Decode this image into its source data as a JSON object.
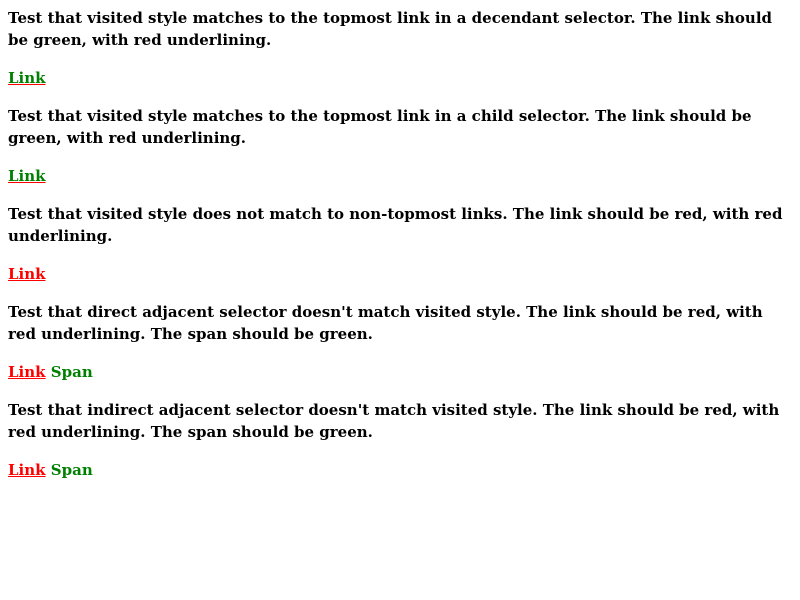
{
  "tests": [
    {
      "description": "Test that visited style matches to the topmost link in a decendant selector. The link should be green, with red underlining.",
      "link": "Link"
    },
    {
      "description": "Test that visited style matches to the topmost link in a child selector. The link should be green, with red underlining.",
      "link": "Link"
    },
    {
      "description": "Test that visited style does not match to non-topmost links. The link should be red, with red underlining.",
      "link": "Link"
    },
    {
      "description": "Test that direct adjacent selector doesn't match visited style. The link should be red, with red underlining. The span should be green.",
      "link": "Link",
      "span": "Span"
    },
    {
      "description": "Test that indirect adjacent selector doesn't match visited style. The link should be red, with red underlining. The span should be green.",
      "link": "Link",
      "span": "Span"
    }
  ],
  "colors": {
    "green": "#008000",
    "red": "#ff0000"
  }
}
